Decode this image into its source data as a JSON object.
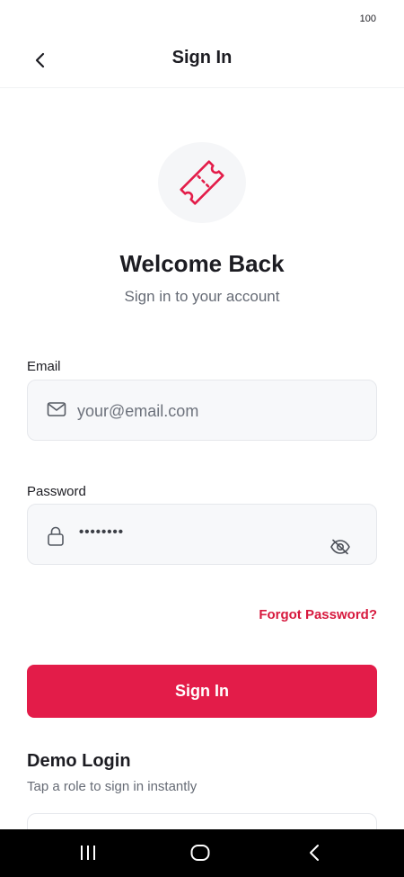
{
  "status_bar": {
    "battery": "100"
  },
  "header": {
    "title": "Sign In",
    "back_icon": "chevron-left-icon"
  },
  "hero": {
    "logo_icon": "ticket-icon",
    "accent_color": "#e31c49",
    "title": "Welcome Back",
    "subtitle": "Sign in to your account"
  },
  "form": {
    "email": {
      "label": "Email",
      "value": "",
      "placeholder": "your@email.com",
      "icon": "mail-icon"
    },
    "password": {
      "label": "Password",
      "masked_value": "••••••••",
      "icon": "lock-icon",
      "toggle_icon": "eye-off-icon"
    },
    "forgot_password": "Forgot Password?",
    "submit_label": "Sign In"
  },
  "demo": {
    "title": "Demo Login",
    "subtitle": "Tap a role to sign in instantly"
  },
  "nav_bar": {
    "recents_icon": "recents-icon",
    "home_icon": "home-icon",
    "back_icon": "back-icon"
  }
}
